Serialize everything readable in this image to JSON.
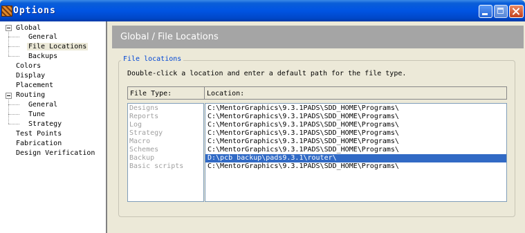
{
  "window": {
    "title": "Options"
  },
  "tree": {
    "global": "Global",
    "global_general": "General",
    "file_locations": "File Locations",
    "backups": "Backups",
    "colors": "Colors",
    "display": "Display",
    "placement": "Placement",
    "routing": "Routing",
    "routing_general": "General",
    "tune": "Tune",
    "strategy": "Strategy",
    "test_points": "Test Points",
    "fabrication": "Fabrication",
    "design_verification": "Design Verification"
  },
  "panel": {
    "header": "Global / File Locations",
    "group_label": "File locations",
    "description": "Double-click a location and enter a default path for the file type.",
    "col_type": "File Type:",
    "col_location": "Location:",
    "types": [
      "Designs",
      "Reports",
      "Log",
      "Strategy",
      "Macro",
      "Schemes",
      "Backup",
      "Basic scripts"
    ],
    "locations": [
      "C:\\MentorGraphics\\9.3.1PADS\\SDD_HOME\\Programs\\",
      "C:\\MentorGraphics\\9.3.1PADS\\SDD_HOME\\Programs\\",
      "C:\\MentorGraphics\\9.3.1PADS\\SDD_HOME\\Programs\\",
      "C:\\MentorGraphics\\9.3.1PADS\\SDD_HOME\\Programs\\",
      "C:\\MentorGraphics\\9.3.1PADS\\SDD_HOME\\Programs\\",
      "C:\\MentorGraphics\\9.3.1PADS\\SDD_HOME\\Programs\\",
      "D:\\pcb backup\\pads9.3.1\\router\\",
      "C:\\MentorGraphics\\9.3.1PADS\\SDD_HOME\\Programs\\"
    ],
    "selected_index": 6
  },
  "colors": {
    "titlebar": "#0054e3",
    "selection": "#316ac5",
    "group_label": "#0046d5",
    "header_band": "#a5a5a5"
  }
}
